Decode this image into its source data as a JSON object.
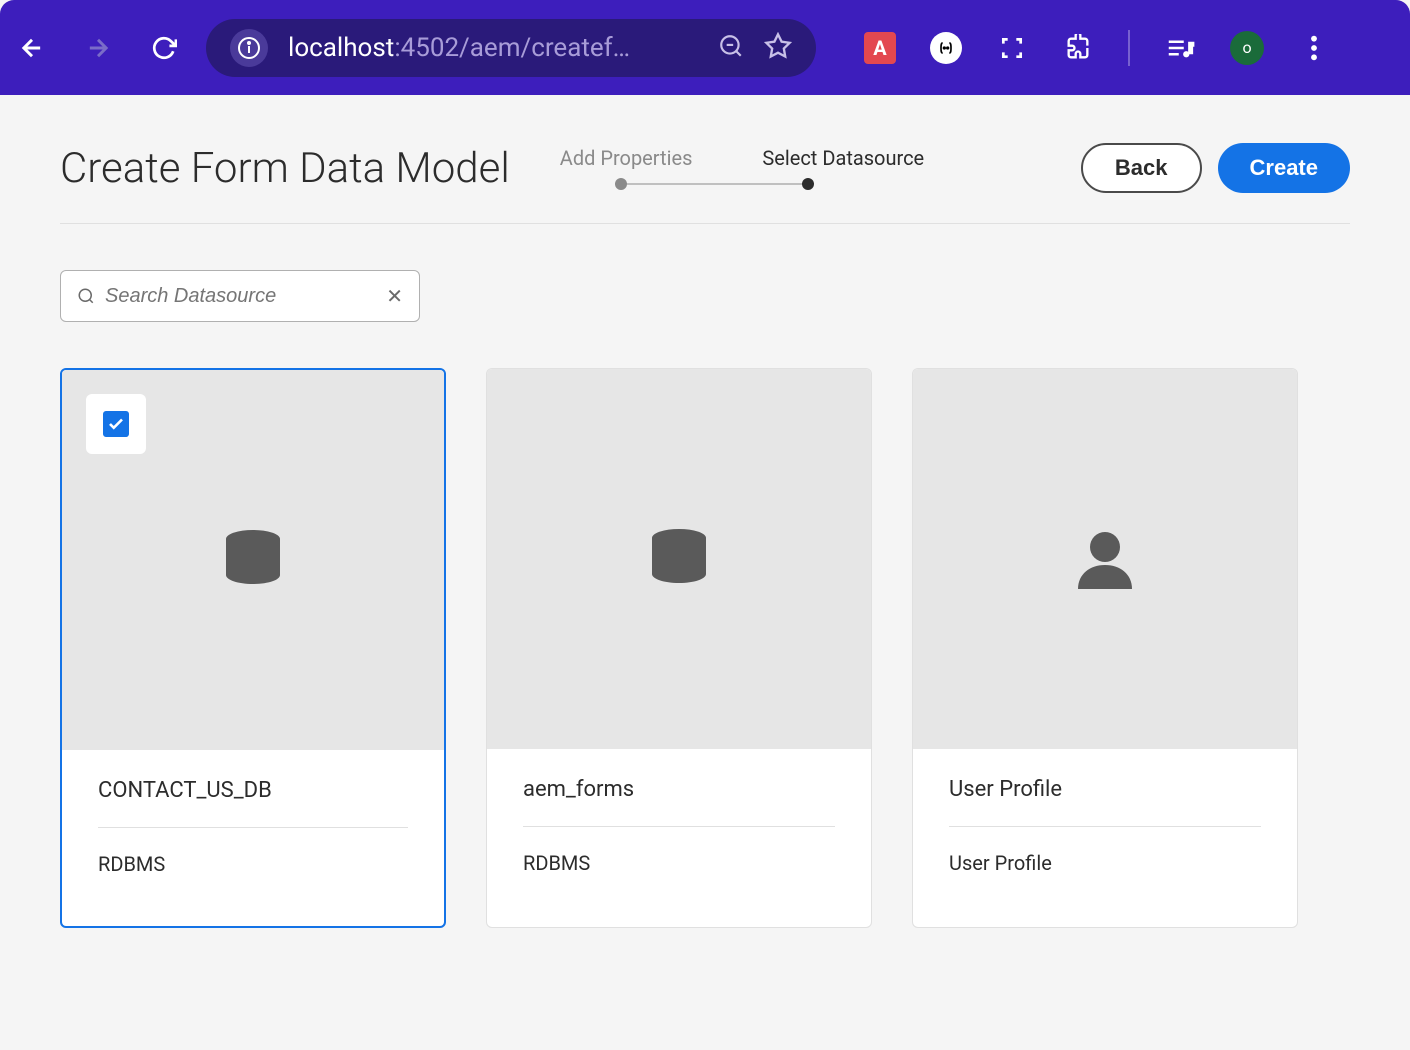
{
  "browser": {
    "url_prefix": "localhost",
    "url_suffix": ":4502/aem/createf…",
    "profile_initial": "o"
  },
  "header": {
    "title": "Create Form Data Model",
    "steps": {
      "step1": "Add Properties",
      "step2": "Select Datasource"
    },
    "buttons": {
      "back": "Back",
      "create": "Create"
    }
  },
  "search": {
    "placeholder": "Search Datasource"
  },
  "cards": [
    {
      "title": "CONTACT_US_DB",
      "subtitle": "RDBMS",
      "icon": "database",
      "selected": true
    },
    {
      "title": "aem_forms",
      "subtitle": "RDBMS",
      "icon": "database",
      "selected": false
    },
    {
      "title": "User Profile",
      "subtitle": "User Profile",
      "icon": "user",
      "selected": false
    }
  ]
}
